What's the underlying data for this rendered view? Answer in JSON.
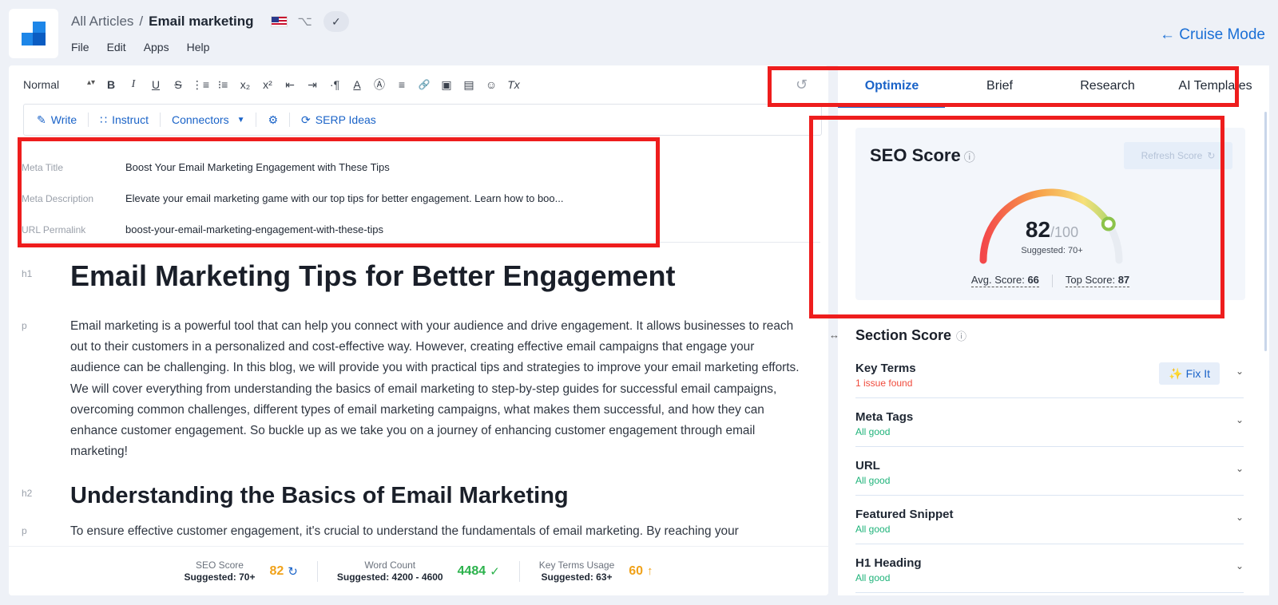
{
  "header": {
    "breadcrumb_root": "All Articles",
    "breadcrumb_sep": "/",
    "breadcrumb_current": "Email marketing",
    "menu": [
      "File",
      "Edit",
      "Apps",
      "Help"
    ],
    "cruise_mode": "← Cruise Mode"
  },
  "toolbar": {
    "style": "Normal",
    "icons": [
      "bold-icon",
      "italic-icon",
      "underline-icon",
      "strikethrough-icon",
      "ordered-list-icon",
      "bullet-list-icon",
      "subscript-icon",
      "superscript-icon",
      "outdent-icon",
      "indent-icon",
      "paragraph-direction-icon",
      "text-color-icon",
      "highlight-icon",
      "align-icon",
      "link-icon",
      "image-icon",
      "video-icon",
      "emoji-icon",
      "clear-format-icon"
    ],
    "glyphs": {
      "bold": "B",
      "italic": "I",
      "underline": "U",
      "strike": "S",
      "ordered": "⋮≡",
      "bullet": "⁝≡",
      "sub": "x₂",
      "sup": "x²",
      "outdent": "⇤",
      "indent": "⇥",
      "pilcrow": "·¶",
      "color": "A",
      "highlight": "Ⓐ",
      "align": "≡",
      "link": "🔗",
      "image": "▣",
      "video": "▤",
      "emoji": "☺",
      "clear": "Tx"
    }
  },
  "ai_bar": {
    "write": "Write",
    "instruct": "Instruct",
    "connectors": "Connectors",
    "serp": "SERP Ideas"
  },
  "meta": {
    "title_label": "Meta Title",
    "title_value": "Boost Your Email Marketing Engagement with These Tips",
    "desc_label": "Meta Description",
    "desc_value": "Elevate your email marketing game with our top tips for better engagement. Learn how to boo...",
    "url_label": "URL Permalink",
    "url_value": "boost-your-email-marketing-engagement-with-these-tips"
  },
  "document": {
    "h1_tag": "h1",
    "h1": "Email Marketing Tips for Better Engagement",
    "p1_tag": "p",
    "p1": "Email marketing is a powerful tool that can help you connect with your audience and drive engagement. It allows businesses to reach out to their customers in a personalized and cost-effective way. However, creating effective email campaigns that engage your audience can be challenging. In this blog, we will provide you with practical tips and strategies to improve your email marketing efforts. We will cover everything from understanding the basics of email marketing to step-by-step guides for successful email campaigns, overcoming common challenges, different types of email marketing campaigns, what makes them successful, and how they can enhance customer engagement. So buckle up as we take you on a journey of enhancing customer engagement through email marketing!",
    "h2_tag": "h2",
    "h2": "Understanding the Basics of Email Marketing",
    "p2_tag": "p",
    "p2": "To ensure effective customer engagement, it's crucial to understand the fundamentals of email marketing. By reaching your"
  },
  "footer": {
    "seo_label": "SEO Score",
    "seo_sugg": "Suggested: 70+",
    "seo_value": "82",
    "wc_label": "Word Count",
    "wc_sugg": "Suggested: 4200 - 4600",
    "wc_value": "4484",
    "kt_label": "Key Terms Usage",
    "kt_sugg": "Suggested: 63+",
    "kt_value": "60",
    "colors": {
      "orange": "#f0a21a",
      "green": "#2bb24c"
    }
  },
  "tabs": [
    "Optimize",
    "Brief",
    "Research",
    "AI Templates"
  ],
  "seo": {
    "title": "SEO Score",
    "refresh": "Refresh Score",
    "score": 82,
    "max": "/100",
    "suggested": "Suggested: 70+",
    "avg_label": "Avg. Score:",
    "avg": "66",
    "top_label": "Top Score:",
    "top": "87"
  },
  "section_score": {
    "title": "Section Score",
    "fix_it": "Fix It",
    "items": [
      {
        "name": "Key Terms",
        "status": "1 issue found",
        "ok": false
      },
      {
        "name": "Meta Tags",
        "status": "All good",
        "ok": true
      },
      {
        "name": "URL",
        "status": "All good",
        "ok": true
      },
      {
        "name": "Featured Snippet",
        "status": "All good",
        "ok": true
      },
      {
        "name": "H1 Heading",
        "status": "All good",
        "ok": true
      }
    ]
  }
}
